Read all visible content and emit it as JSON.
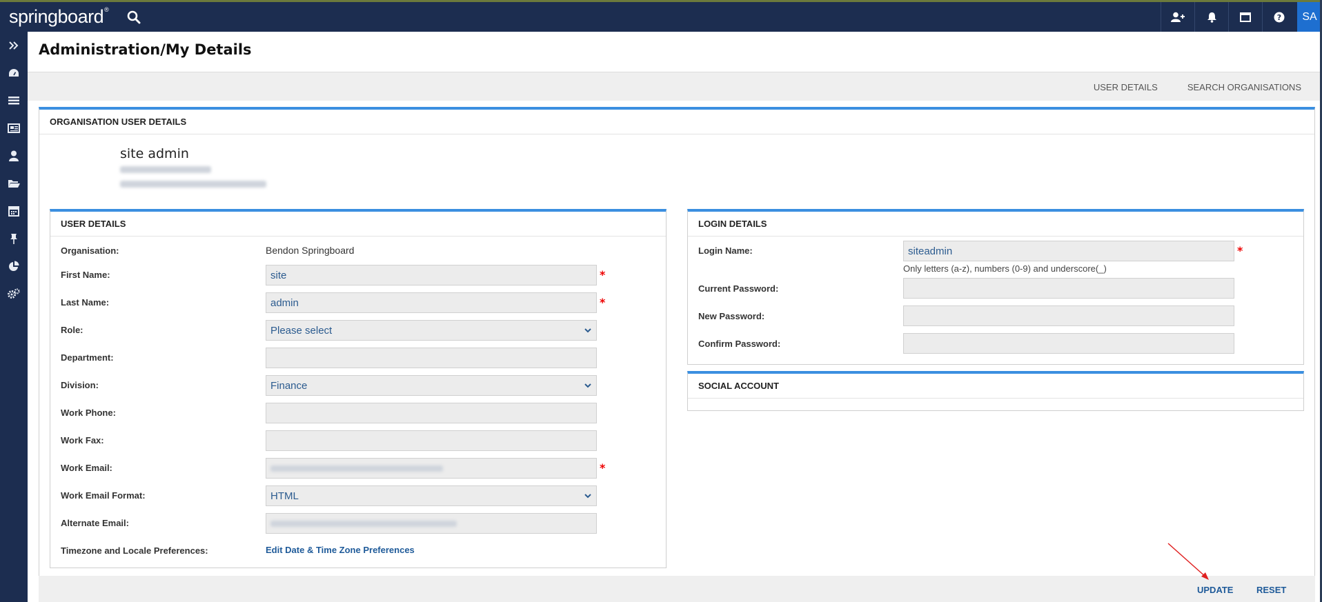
{
  "app": {
    "logo_text": "springboard",
    "logo_mark": "®"
  },
  "topbar": {
    "icons": [
      "search-icon",
      "add-user-icon",
      "bell-icon",
      "window-icon",
      "help-icon"
    ],
    "avatar_initials": "SA"
  },
  "sidebar": {
    "icons": [
      "expand-icon",
      "dashboard-icon",
      "list-icon",
      "news-icon",
      "user-icon",
      "folder-icon",
      "calendar-icon",
      "pin-icon",
      "pie-chart-icon",
      "settings-icon"
    ]
  },
  "page": {
    "title": "Administration/My Details"
  },
  "subnav": {
    "user_details": "USER DETAILS",
    "search_organisations": "SEARCH ORGANISATIONS"
  },
  "org_panel": {
    "heading": "ORGANISATION USER DETAILS",
    "display_name": "site admin"
  },
  "user_details": {
    "heading": "USER DETAILS",
    "organisation_label": "Organisation:",
    "organisation_value": "Bendon Springboard",
    "first_name_label": "First Name:",
    "first_name_value": "site",
    "last_name_label": "Last Name:",
    "last_name_value": "admin",
    "role_label": "Role:",
    "role_value": "Please select",
    "department_label": "Department:",
    "department_value": "",
    "division_label": "Division:",
    "division_value": "Finance",
    "work_phone_label": "Work Phone:",
    "work_phone_value": "",
    "work_fax_label": "Work Fax:",
    "work_fax_value": "",
    "work_email_label": "Work Email:",
    "work_email_format_label": "Work Email Format:",
    "work_email_format_value": "HTML",
    "alternate_email_label": "Alternate Email:",
    "timezone_label": "Timezone and Locale Preferences:",
    "timezone_link": "Edit Date & Time Zone Preferences",
    "required_mark": "*"
  },
  "login_details": {
    "heading": "LOGIN DETAILS",
    "login_name_label": "Login Name:",
    "login_name_value": "siteadmin",
    "login_name_hint": "Only letters (a-z), numbers (0-9) and underscore(_)",
    "current_password_label": "Current Password:",
    "new_password_label": "New Password:",
    "confirm_password_label": "Confirm Password:"
  },
  "social_account": {
    "heading": "SOCIAL ACCOUNT"
  },
  "actions": {
    "update": "UPDATE",
    "reset": "RESET"
  },
  "colors": {
    "navy": "#1c2d50",
    "accent_blue": "#3b8fe0",
    "link_blue": "#1e5a99",
    "required_red": "#ee0000",
    "annotation_arrow": "#e02020"
  }
}
